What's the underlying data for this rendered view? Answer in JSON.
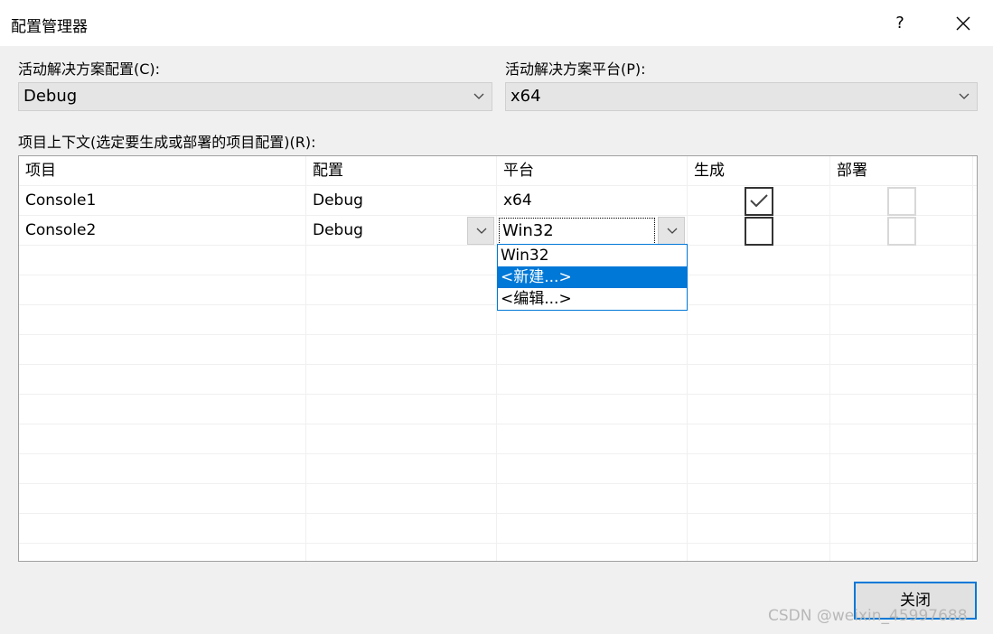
{
  "window": {
    "title": "配置管理器",
    "help_label": "?"
  },
  "active_config": {
    "label": "活动解决方案配置(C):",
    "value": "Debug"
  },
  "active_platform": {
    "label": "活动解决方案平台(P):",
    "value": "x64"
  },
  "project_context_label": "项目上下文(选定要生成或部署的项目配置)(R):",
  "table": {
    "headers": [
      "项目",
      "配置",
      "平台",
      "生成",
      "部署"
    ],
    "rows": [
      {
        "project": "Console1",
        "config": "Debug",
        "platform": "x64",
        "build": true,
        "deploy": false
      },
      {
        "project": "Console2",
        "config": "Debug",
        "platform": "Win32",
        "build": false,
        "deploy": false
      }
    ]
  },
  "platform_dropdown": {
    "options": [
      "Win32",
      "<新建...>",
      "<编辑...>"
    ],
    "highlighted": "<新建...>"
  },
  "footer": {
    "close_label": "关闭"
  },
  "watermark": "CSDN @weixin_45997688",
  "colors": {
    "accent": "#0078d7",
    "dialog_bg": "#f0f0f0"
  }
}
